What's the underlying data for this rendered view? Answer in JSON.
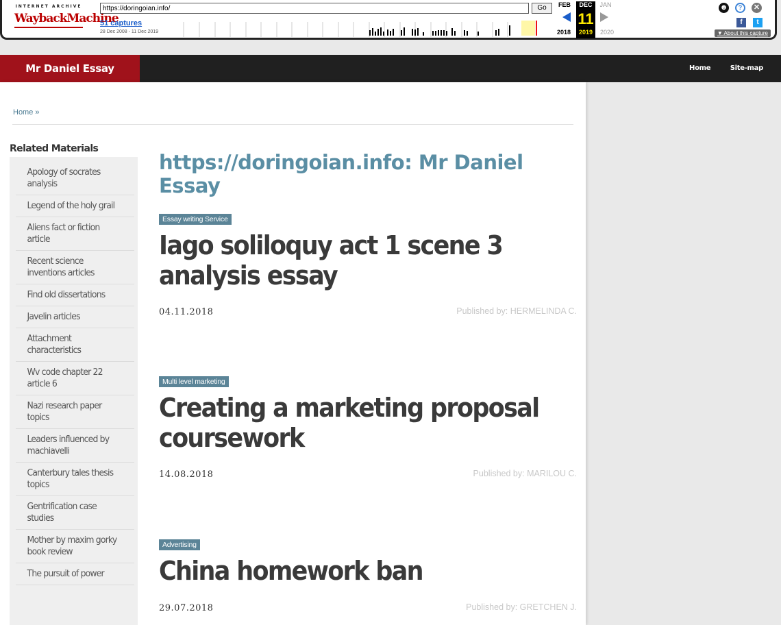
{
  "wayback": {
    "logo_top": "INTERNET ARCHIVE",
    "logo_main": "WaybackMachine",
    "url": "https://doringoian.info/",
    "go_label": "Go",
    "captures": "51 captures",
    "date_range": "28 Dec 2008 - 11 Dec 2019",
    "months": {
      "prev": "FEB",
      "current": "DEC",
      "next": "JAN"
    },
    "day": "11",
    "years": {
      "prev": "2018",
      "current": "2019",
      "next": "2020"
    },
    "about": "About this capture"
  },
  "header": {
    "brand": "Mr Daniel Essay",
    "nav": [
      "Home",
      "Site-map"
    ]
  },
  "breadcrumb": {
    "home": "Home",
    "sep": "»"
  },
  "sidebar": {
    "title": "Related Materials",
    "items": [
      "Apology of socrates analysis",
      "Legend of the holy grail",
      "Aliens fact or fiction article",
      "Recent science inventions articles",
      "Find old dissertations",
      "Javelin articles",
      "Attachment characteristics",
      "Wv code chapter 22 article 6",
      "Nazi research paper topics",
      "Leaders influenced by machiavelli",
      "Canterbury tales thesis topics",
      "Gentrification case studies",
      "Mother by maxim gorky book review",
      "The pursuit of power"
    ]
  },
  "main": {
    "title_prefix": "https://doringoian.info: ",
    "title_bold": "Mr Daniel Essay",
    "articles": [
      {
        "tag": "Essay writing Service",
        "title": "Iago soliloquy act 1 scene 3 analysis essay",
        "date": "04.11.2018",
        "author": "Published by: HERMELINDA C."
      },
      {
        "tag": "Multi level marketing",
        "title": "Creating a marketing proposal coursework",
        "date": "14.08.2018",
        "author": "Published by: MARILOU C."
      },
      {
        "tag": "Advertising",
        "title": "China homework ban",
        "date": "29.07.2018",
        "author": "Published by: GRETCHEN J."
      }
    ]
  }
}
